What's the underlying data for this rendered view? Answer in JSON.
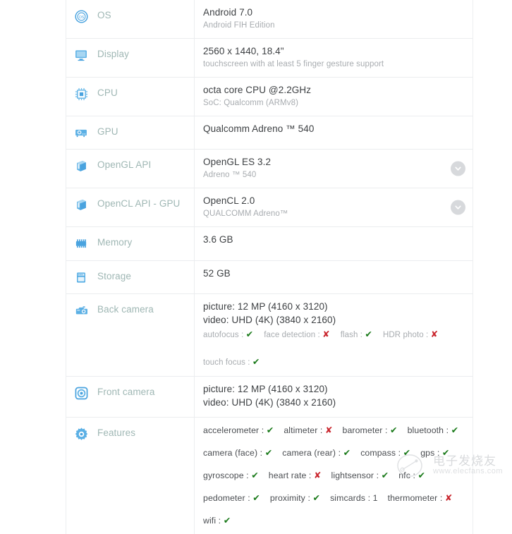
{
  "page": {
    "title": "Device specification sheet",
    "watermark": {
      "text": "电子发烧友",
      "url": "www.elecfans.com"
    }
  },
  "colors": {
    "label": "#9fb7b4",
    "icon": "#4aa3df",
    "value_primary": "#3d4043",
    "value_secondary": "#a8acb0",
    "yes": "#1a7a1a",
    "no": "#c9252d",
    "row_border": "#ebedef",
    "chevron_bg": "#d7d9dc"
  },
  "glyphs": {
    "yes": "✔",
    "no": "✘"
  },
  "rows": [
    {
      "id": "os",
      "icon": "os-icon",
      "label": "OS",
      "primary": "Android 7.0",
      "secondary": "Android FIH Edition",
      "expandable": false
    },
    {
      "id": "display",
      "icon": "display-icon",
      "label": "Display",
      "primary": "2560 x 1440, 18.4\"",
      "secondary": "touchscreen with at least 5 finger gesture support",
      "expandable": false
    },
    {
      "id": "cpu",
      "icon": "cpu-icon",
      "label": "CPU",
      "primary": "octa core CPU @2.2GHz",
      "secondary": "SoC: Qualcomm (ARMv8)",
      "expandable": false
    },
    {
      "id": "gpu",
      "icon": "gpu-icon",
      "label": "GPU",
      "primary": "Qualcomm Adreno ™ 540",
      "secondary": "",
      "expandable": false
    },
    {
      "id": "opengl",
      "icon": "opengl-icon",
      "label": "OpenGL API",
      "primary": "OpenGL ES 3.2",
      "secondary": "Adreno ™ 540",
      "expandable": true
    },
    {
      "id": "opencl",
      "icon": "opencl-icon",
      "label": "OpenCL API - GPU",
      "primary": "OpenCL 2.0",
      "secondary": "QUALCOMM Adreno™",
      "expandable": true
    },
    {
      "id": "memory",
      "icon": "memory-icon",
      "label": "Memory",
      "primary": "3.6 GB",
      "secondary": "",
      "expandable": false
    },
    {
      "id": "storage",
      "icon": "storage-icon",
      "label": "Storage",
      "primary": "52 GB",
      "secondary": "",
      "expandable": false
    }
  ],
  "back_camera": {
    "icon": "back-camera-icon",
    "label": "Back camera",
    "picture": "picture: 12 MP (4160 x 3120)",
    "video": "video: UHD (4K) (3840 x 2160)",
    "flags_line1": [
      {
        "name": "autofocus",
        "value": "yes"
      },
      {
        "name": "face detection",
        "value": "no"
      },
      {
        "name": "flash",
        "value": "yes"
      },
      {
        "name": "HDR photo",
        "value": "no"
      }
    ],
    "flags_line2": [
      {
        "name": "touch focus",
        "value": "yes"
      }
    ]
  },
  "front_camera": {
    "icon": "front-camera-icon",
    "label": "Front camera",
    "picture": "picture: 12 MP (4160 x 3120)",
    "video": "video: UHD (4K) (3840 x 2160)"
  },
  "features": {
    "icon": "features-icon",
    "label": "Features",
    "lines": [
      [
        {
          "name": "accelerometer",
          "value": "yes"
        },
        {
          "name": "altimeter",
          "value": "no"
        },
        {
          "name": "barometer",
          "value": "yes"
        },
        {
          "name": "bluetooth",
          "value": "yes"
        }
      ],
      [
        {
          "name": "camera (face)",
          "value": "yes"
        },
        {
          "name": "camera (rear)",
          "value": "yes"
        },
        {
          "name": "compass",
          "value": "yes"
        },
        {
          "name": "gps",
          "value": "yes"
        }
      ],
      [
        {
          "name": "gyroscope",
          "value": "yes"
        },
        {
          "name": "heart rate",
          "value": "no"
        },
        {
          "name": "lightsensor",
          "value": "yes"
        },
        {
          "name": "nfc",
          "value": "yes"
        }
      ],
      [
        {
          "name": "pedometer",
          "value": "yes"
        },
        {
          "name": "proximity",
          "value": "yes"
        },
        {
          "name": "simcards",
          "value": "1"
        },
        {
          "name": "thermometer",
          "value": "no"
        }
      ],
      [
        {
          "name": "wifi",
          "value": "yes"
        }
      ]
    ]
  }
}
